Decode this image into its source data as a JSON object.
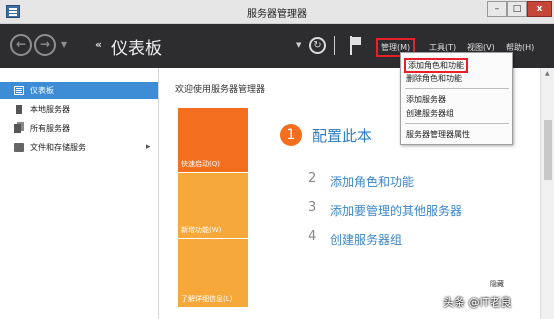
{
  "window": {
    "title": "服务器管理器",
    "controls": {
      "minimize": "–",
      "maximize": "□",
      "close": "x"
    }
  },
  "nav": {
    "back": "←",
    "forward": "→",
    "breadcrumb_arrows": "‹‹",
    "breadcrumb": "仪表板",
    "menus": [
      {
        "label": "管理(M)"
      },
      {
        "label": "工具(T)"
      },
      {
        "label": "视图(V)"
      },
      {
        "label": "帮助(H)"
      }
    ]
  },
  "sidebar": {
    "items": [
      {
        "label": "仪表板",
        "icon": "dashboard-icon",
        "active": true
      },
      {
        "label": "本地服务器",
        "icon": "server-icon"
      },
      {
        "label": "所有服务器",
        "icon": "servers-icon"
      },
      {
        "label": "文件和存储服务",
        "icon": "storage-icon",
        "chevron": "▸"
      }
    ]
  },
  "main": {
    "welcome": "欢迎使用服务器管理器",
    "tiles": [
      "快速启动(Q)",
      "新增功能(W)",
      "了解详细信息(L)"
    ],
    "step1": {
      "number": "1",
      "label": "配置此本"
    },
    "steps": [
      {
        "number": "2",
        "label": "添加角色和功能"
      },
      {
        "number": "3",
        "label": "添加要管理的其他服务器"
      },
      {
        "number": "4",
        "label": "创建服务器组"
      }
    ],
    "hide": "隐藏"
  },
  "manage_menu": {
    "items": [
      {
        "label": "添加角色和功能",
        "highlighted": true
      },
      {
        "label": "删除角色和功能"
      },
      {
        "label": "添加服务器"
      },
      {
        "label": "创建服务器组"
      },
      {
        "label": "服务器管理器属性"
      }
    ]
  },
  "watermark": "头条 @IT老良",
  "colors": {
    "accent": "#3c8dd6",
    "tile_orange": "#f36f1f",
    "tile_light": "#f7a83b",
    "highlight_border": "#e8202a",
    "navbar": "#2d2d30"
  }
}
